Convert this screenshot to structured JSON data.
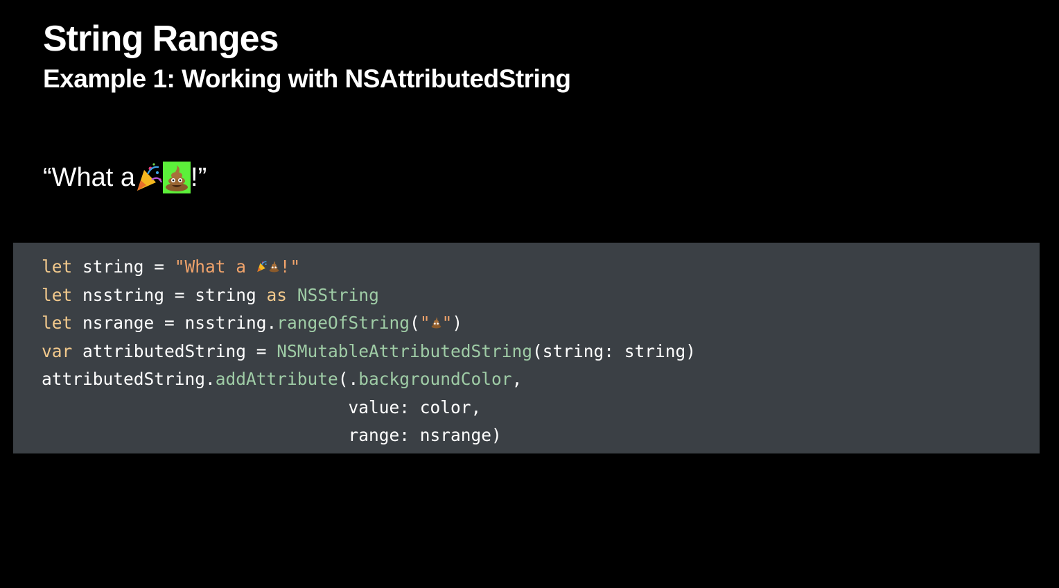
{
  "slide": {
    "title": "String Ranges",
    "subtitle": "Example 1: Working with NSAttributedString",
    "sample": {
      "prefix": "“What a ",
      "emoji_1": "party-popper-icon",
      "emoji_2": "pile-of-poo-icon",
      "suffix": "!”",
      "highlight_color": "#5cf03a"
    }
  },
  "code": {
    "background": "#3b4045",
    "colors": {
      "keyword": "#f2c98c",
      "string": "#f0a36b",
      "type": "#9fcca6",
      "plain": "#ffffff"
    },
    "line1": {
      "kw": "let",
      "a": " string = ",
      "str_open": "\"What a ",
      "str_close": "!\""
    },
    "line2": {
      "kw": "let",
      "a": " nsstring = string ",
      "kw2": "as",
      "sp": " ",
      "type": "NSString"
    },
    "line3": {
      "kw": "let",
      "a": " nsrange = nsstring.",
      "fn": "rangeOfString",
      "b": "(",
      "str_open": "\"",
      "str_close": "\"",
      "c": ")"
    },
    "line4": {
      "kw": "var",
      "a": " attributedString = ",
      "type": "NSMutableAttributedString",
      "b": "(string: string)"
    },
    "line5": {
      "a": "attributedString.",
      "fn": "addAttribute",
      "b": "(.",
      "fn2": "backgroundColor",
      "c": ","
    },
    "line6": {
      "a": "                              value: color,"
    },
    "line7": {
      "a": "                              range: nsrange)"
    }
  }
}
